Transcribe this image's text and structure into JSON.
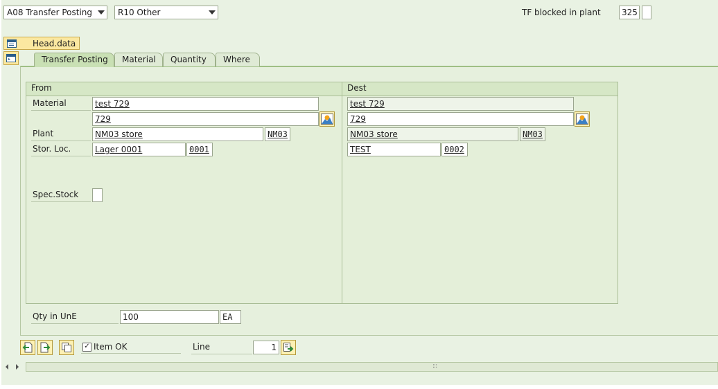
{
  "toolbar": {
    "action": "A08 Transfer Posting",
    "reference": "R10 Other",
    "tf_blocked_label": "TF blocked in plant",
    "tf_blocked_value": "325"
  },
  "head_data_label": "Head.data",
  "tabs": [
    {
      "label": "Transfer Posting"
    },
    {
      "label": "Material"
    },
    {
      "label": "Quantity"
    },
    {
      "label": "Where"
    }
  ],
  "from": {
    "header": "From",
    "material_label": "Material",
    "material_desc": "test 729",
    "material_no": "729",
    "plant_label": "Plant",
    "plant_name": "NM03 store",
    "plant_code": "NM03",
    "stor_loc_label": "Stor. Loc.",
    "stor_loc_name": "Lager 0001",
    "stor_loc_code": "0001",
    "spec_stock_label": "Spec.Stock",
    "spec_stock_value": ""
  },
  "dest": {
    "header": "Dest",
    "material_desc": "test 729",
    "material_no": "729",
    "plant_name": "NM03 store",
    "plant_code": "NM03",
    "stor_loc_name": "TEST",
    "stor_loc_code": "0002"
  },
  "quantity": {
    "label": "Qty in UnE",
    "value": "100",
    "unit": "EA"
  },
  "footer": {
    "item_ok_label": "Item OK",
    "item_ok_checked": "✓",
    "line_label": "Line",
    "line_value": "1",
    "scroll_grip": ":::"
  },
  "colors": {
    "background": "#e9f2e3",
    "panel": "#e4efd9",
    "button_yellow": "#fdf1b4",
    "tab_active": "#c9e0b4"
  }
}
